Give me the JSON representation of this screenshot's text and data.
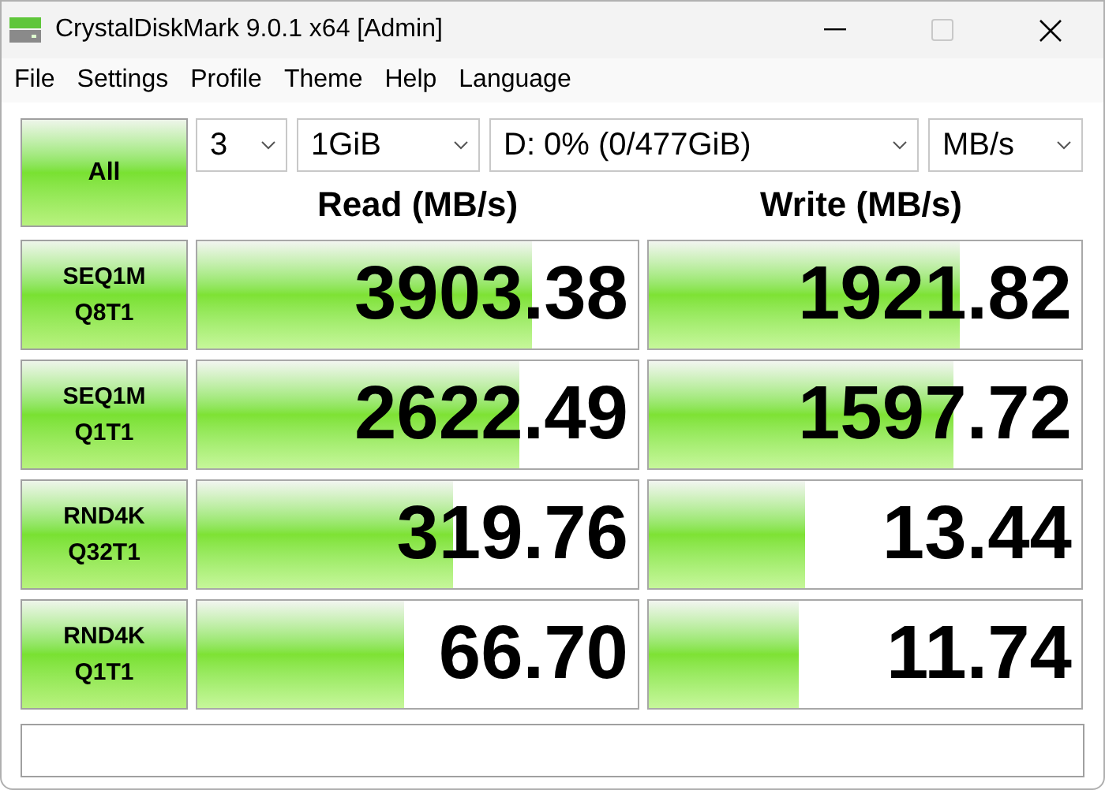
{
  "window": {
    "title": "CrystalDiskMark 9.0.1 x64 [Admin]",
    "maximize_disabled": true
  },
  "menu": [
    "File",
    "Settings",
    "Profile",
    "Theme",
    "Help",
    "Language"
  ],
  "toolbar": {
    "all_button": "All",
    "dropdowns": [
      {
        "value": "3"
      },
      {
        "value": "1GiB"
      },
      {
        "value": "D: 0% (0/477GiB)"
      },
      {
        "value": "MB/s"
      }
    ]
  },
  "headers": {
    "read": "Read (MB/s)",
    "write": "Write (MB/s)"
  },
  "rows": [
    {
      "test": "SEQ1M",
      "params": "Q8T1",
      "read": {
        "value": "3903.38",
        "level": 0.76
      },
      "write": {
        "value": "1921.82",
        "level": 0.72
      }
    },
    {
      "test": "SEQ1M",
      "params": "Q1T1",
      "read": {
        "value": "2622.49",
        "level": 0.73
      },
      "write": {
        "value": "1597.72",
        "level": 0.705
      }
    },
    {
      "test": "RND4K",
      "params": "Q32T1",
      "read": {
        "value": "319.76",
        "level": 0.58
      },
      "write": {
        "value": "13.44",
        "level": 0.36
      }
    },
    {
      "test": "RND4K",
      "params": "Q1T1",
      "read": {
        "value": "66.70",
        "level": 0.47
      },
      "write": {
        "value": "11.74",
        "level": 0.345
      }
    }
  ]
}
